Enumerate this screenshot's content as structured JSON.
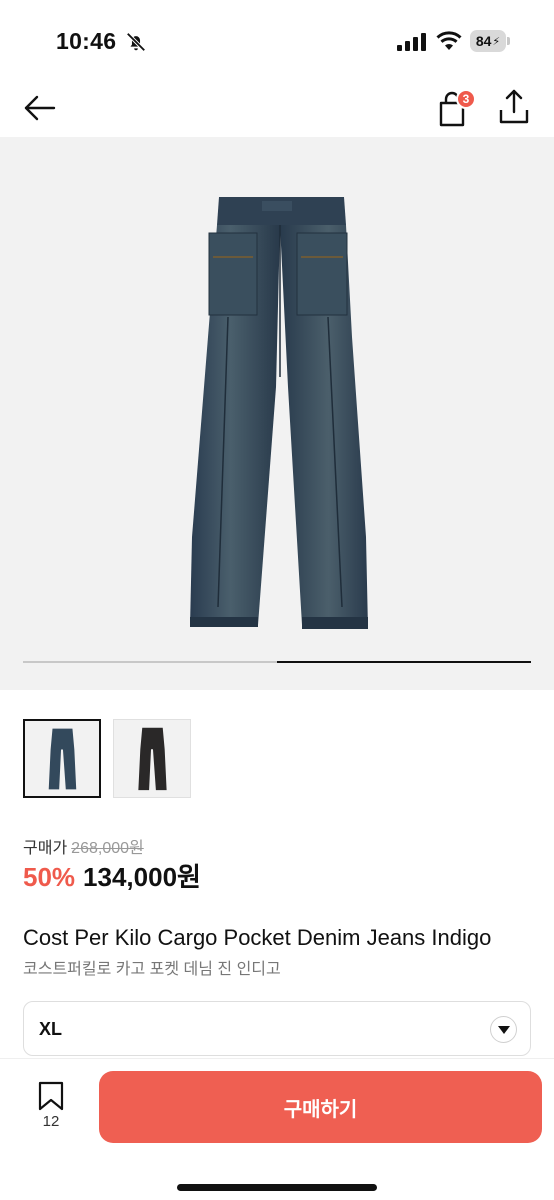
{
  "status_bar": {
    "time": "10:46",
    "battery": "84"
  },
  "header": {
    "cart_count": "3"
  },
  "gallery": {
    "image_count": 2,
    "current_index": 2
  },
  "price": {
    "label": "구매가",
    "original": "268,000원",
    "discount": "50%",
    "final": "134,000원"
  },
  "product": {
    "title_en": "Cost Per Kilo Cargo Pocket Denim Jeans Indigo",
    "title_ko": "코스트퍼킬로 카고 포켓 데님 진 인디고"
  },
  "size_select": {
    "value": "XL"
  },
  "bottom_bar": {
    "bookmark_count": "12",
    "buy_label": "구매하기"
  },
  "colors": {
    "accent": "#ef5f52",
    "badge": "#ef5a4c",
    "denim": "#2f4459"
  },
  "icons": [
    "bell-slash-icon",
    "signal-icon",
    "wifi-icon",
    "battery-icon",
    "arrow-left-icon",
    "shopping-bag-icon",
    "share-icon",
    "chevron-down-icon",
    "bookmark-icon"
  ]
}
